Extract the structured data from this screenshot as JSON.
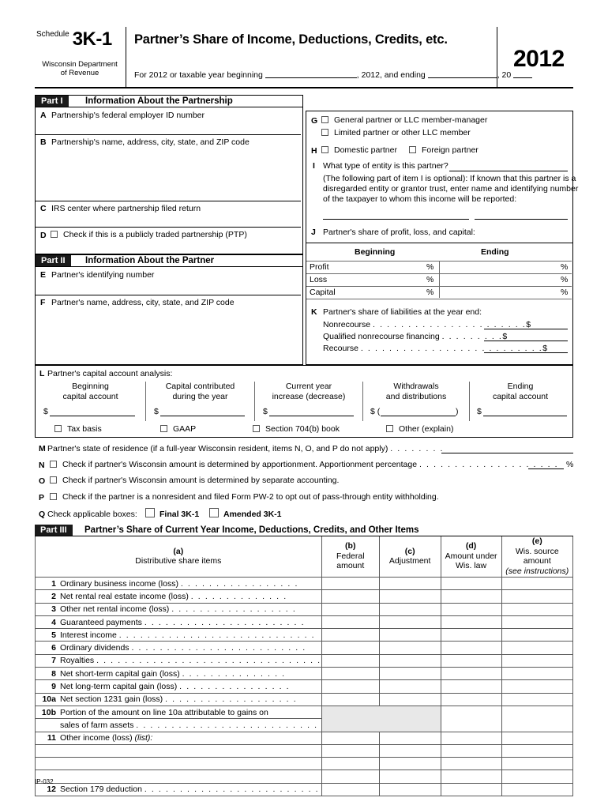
{
  "header": {
    "schedule_word": "Schedule",
    "schedule_number": "3K-1",
    "department_line1": "Wisconsin Department",
    "department_line2": "of Revenue",
    "title": "Partner’s Share of Income, Deductions, Credits, etc.",
    "tax_year_prefix": "For 2012 or taxable year beginning",
    "tax_year_mid": ", 2012, and ending",
    "tax_year_suffix": ", 20",
    "year": "2012"
  },
  "part1": {
    "tag": "Part I",
    "title": "Information About the Partnership",
    "a_letter": "A",
    "a_label": "Partnership's federal employer ID number",
    "b_letter": "B",
    "b_label": "Partnership's name, address, city, state, and ZIP code",
    "c_letter": "C",
    "c_label": "IRS center where partnership filed return",
    "d_letter": "D",
    "d_label": "Check if this is a publicly traded partnership (PTP)"
  },
  "part2": {
    "tag": "Part II",
    "title": "Information About the Partner",
    "e_letter": "E",
    "e_label": "Partner's identifying number",
    "f_letter": "F",
    "f_label": "Partner's name, address, city, state, and ZIP code"
  },
  "right": {
    "g_letter": "G",
    "g_option1": "General partner or LLC member-manager",
    "g_option2": "Limited partner or other LLC member",
    "h_letter": "H",
    "h_option1": "Domestic partner",
    "h_option2": "Foreign partner",
    "i_letter": "I",
    "i_question": "What type of entity is this partner?",
    "i_note_line1": "(The following part of item I is optional):  If known that this partner is a",
    "i_note_line2": "disregarded entity or grantor trust, enter name and identifying number",
    "i_note_line3": "of the taxpayer to whom this income will be reported:",
    "j_letter": "J",
    "j_label": "Partner's share of profit, loss, and capital:",
    "j_col_beginning": "Beginning",
    "j_col_ending": "Ending",
    "j_rows": [
      "Profit",
      "Loss",
      "Capital"
    ],
    "percent": "%",
    "k_letter": "K",
    "k_label": "Partner's share of liabilities at the year end:",
    "k_rows": [
      {
        "label": "Nonrecourse",
        "dots": ". . . . . . . . . . . . . . . . . . . . . .",
        "dollar": "$"
      },
      {
        "label": "Qualified nonrecourse financing",
        "dots": ". . . . . . . . .",
        "dollar": "$"
      },
      {
        "label": "Recourse",
        "dots": ". . . . . . . . . . . . . . . . . . . . . . . . . .",
        "dollar": "$"
      }
    ]
  },
  "capital": {
    "l_letter": "L",
    "l_label": "Partner's capital account analysis:",
    "columns": [
      {
        "line1": "Beginning",
        "line2": "capital account",
        "dollar": "$",
        "paren": false
      },
      {
        "line1": "Capital contributed",
        "line2": "during the year",
        "dollar": "$",
        "paren": false
      },
      {
        "line1": "Current year",
        "line2": "increase (decrease)",
        "dollar": "$",
        "paren": false
      },
      {
        "line1": "Withdrawals",
        "line2": "and distributions",
        "dollar": "$",
        "paren": true
      },
      {
        "line1": "Ending",
        "line2": "capital account",
        "dollar": "$",
        "paren": false
      }
    ],
    "basis_options": [
      "Tax basis",
      "GAAP",
      "Section 704(b) book",
      "Other (explain)"
    ]
  },
  "items": {
    "m_letter": "M",
    "m_label": "Partner's state of residence (if a full-year Wisconsin resident, items N, O, and P do not apply)",
    "m_dots": ". . . . . . . .",
    "n_letter": "N",
    "n_label": "Check if partner's Wisconsin amount is determined by apportionment. Apportionment percentage",
    "n_dots": ". . . . . . . . . . . . . . . . . . . .",
    "n_percent": "%",
    "o_letter": "O",
    "o_label": "Check if partner's Wisconsin amount is determined by separate accounting.",
    "p_letter": "P",
    "p_label": "Check if the partner is a nonresident and filed Form PW-2 to opt out of pass-through entity withholding.",
    "q_letter": "Q",
    "q_label": "Check applicable boxes:",
    "q_option1": "Final 3K-1",
    "q_option2": "Amended 3K-1"
  },
  "part3": {
    "tag": "Part III",
    "title": "Partner’s Share of Current Year Income, Deductions, Credits, and Other Items",
    "columns": [
      {
        "tag": "(a)",
        "line1": "",
        "line2": "Distributive share items",
        "italic2": false
      },
      {
        "tag": "(b)",
        "line1": "",
        "line2": "Federal amount",
        "italic2": false
      },
      {
        "tag": "(c)",
        "line1": "",
        "line2": "Adjustment",
        "italic2": false
      },
      {
        "tag": "(d)",
        "line1": "Amount under",
        "line2": "Wis. law",
        "italic2": false
      },
      {
        "tag": "(e)",
        "line1": "Wis. source amount",
        "line2": "(see instructions)",
        "italic2": true
      }
    ],
    "rows": [
      {
        "num": "1",
        "text": "Ordinary business income (loss)",
        "dots": ". . . . . . . . . . . . . . . . .",
        "shaded": false
      },
      {
        "num": "2",
        "text": "Net rental real estate income (loss)",
        "dots": ". . . . . . . . . . . . . .",
        "shaded": false
      },
      {
        "num": "3",
        "text": "Other net rental income (loss)",
        "dots": ". . . . . . . . . . . . . . . . . .",
        "shaded": false
      },
      {
        "num": "4",
        "text": "Guaranteed payments",
        "dots": ". . . . . . . . . . . . . . . . . . . . . . .",
        "shaded": false
      },
      {
        "num": "5",
        "text": "Interest income",
        "dots": ". . . . . . . . . . . . . . . . . . . . . . . . . . . .",
        "shaded": false
      },
      {
        "num": "6",
        "text": "Ordinary dividends",
        "dots": ". . . . . . . . . . . . . . . . . . . . . . . . .",
        "shaded": false
      },
      {
        "num": "7",
        "text": "Royalties",
        "dots": ". . . . . . . . . . . . . . . . . . . . . . . . . . . . . . . .",
        "shaded": false
      },
      {
        "num": "8",
        "text": "Net short-term capital gain (loss)",
        "dots": ". . . . . . . . . . . . . . .",
        "shaded": false
      },
      {
        "num": "9",
        "text": "Net long-term capital gain (loss)",
        "dots": ". . . . . . . . . . . . . . . .",
        "shaded": false
      },
      {
        "num": "10a",
        "text": "Net section 1231 gain (loss)",
        "dots": ". . . . . . . . . . . . . . . . . . .",
        "shaded": false
      }
    ],
    "row10b_line1": "Portion of the amount on line 10a attributable to gains on",
    "row10b_num": "10b",
    "row10b_line2": "sales of farm assets",
    "row10b_dots": ". . . . . . . . . . . . . . . . . . . . . . . . . .",
    "row11_num": "11",
    "row11_text": "Other income (loss)",
    "row11_italic": "(list):",
    "row12_num": "12",
    "row12_text": "Section 179 deduction",
    "row12_dots": ". . . . . . . . . . . . . . . . . . . . . . . . ."
  },
  "footer": {
    "code": "IP-032"
  }
}
